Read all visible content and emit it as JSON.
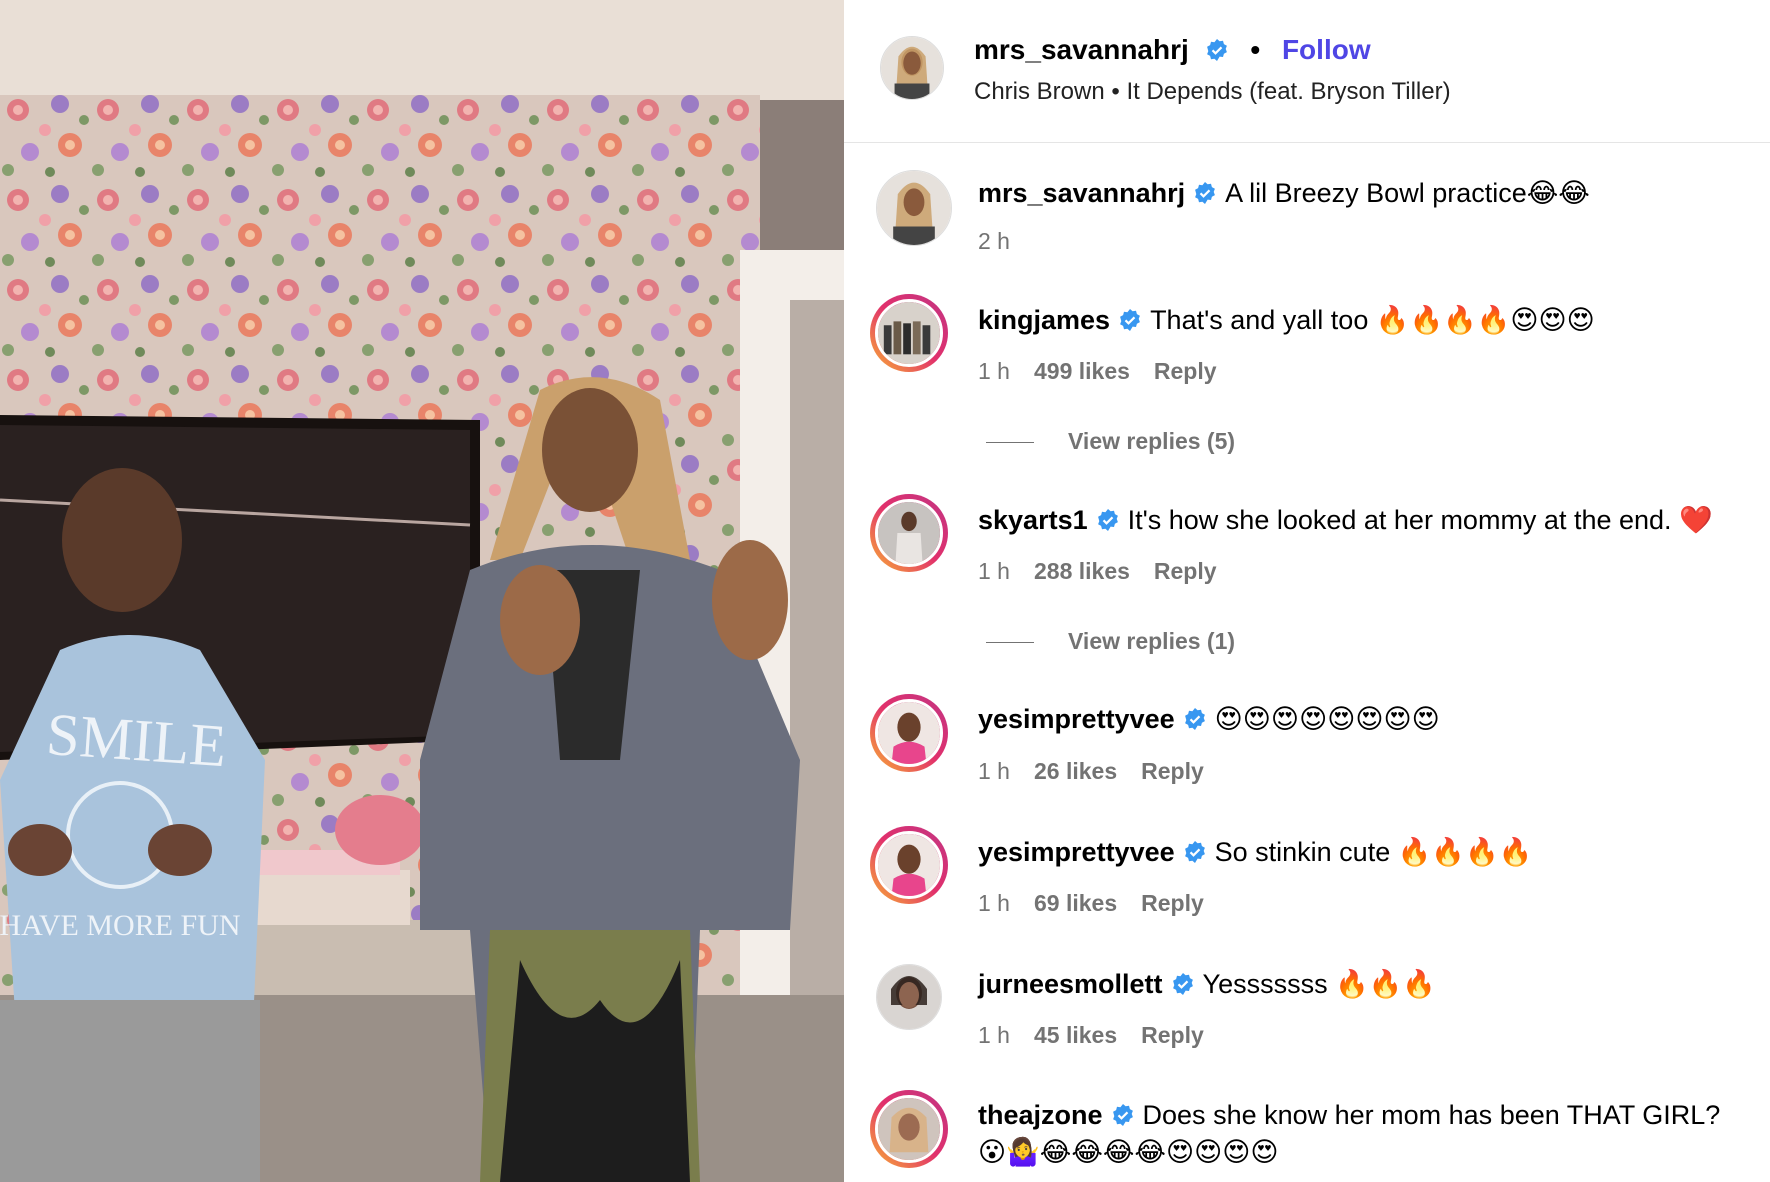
{
  "header": {
    "username": "mrs_savannahrj",
    "follow_label": "Follow",
    "dot": "•",
    "audio": "Chris Brown • It Depends (feat. Bryson Tiller)"
  },
  "caption": {
    "username": "mrs_savannahrj",
    "text": "A lil Breezy Bowl practice😂😂",
    "time": "2 h"
  },
  "comments": [
    {
      "username": "kingjames",
      "text": "That's and yall too 🔥🔥🔥🔥😍😍😍",
      "time": "1 h",
      "likes": "499 likes",
      "reply": "Reply",
      "view_replies": "View replies (5)"
    },
    {
      "username": "skyarts1",
      "text": "It's how she looked at her mommy at the end. ❤️",
      "time": "1 h",
      "likes": "288 likes",
      "reply": "Reply",
      "view_replies": "View replies (1)"
    },
    {
      "username": "yesimprettyvee",
      "text": "😍😍😍😍😍😍😍😍",
      "time": "1 h",
      "likes": "26 likes",
      "reply": "Reply"
    },
    {
      "username": "yesimprettyvee",
      "text": "So stinkin cute 🔥🔥🔥🔥",
      "time": "1 h",
      "likes": "69 likes",
      "reply": "Reply"
    },
    {
      "username": "jurneesmollett",
      "text": "Yesssssss 🔥🔥🔥",
      "time": "1 h",
      "likes": "45 likes",
      "reply": "Reply"
    },
    {
      "username": "theajzone",
      "text": "Does she know her mom has been THAT GIRL?",
      "text2": "😮🤷‍♀️😂😂😂😂😍😍😍😍"
    }
  ],
  "media": {
    "shirt_text_top": "SMILE",
    "shirt_text_bottom": "HAVE MORE FUN"
  },
  "colors": {
    "accent": "#4f46e5",
    "verified": "#3897f0",
    "muted": "#737373"
  }
}
